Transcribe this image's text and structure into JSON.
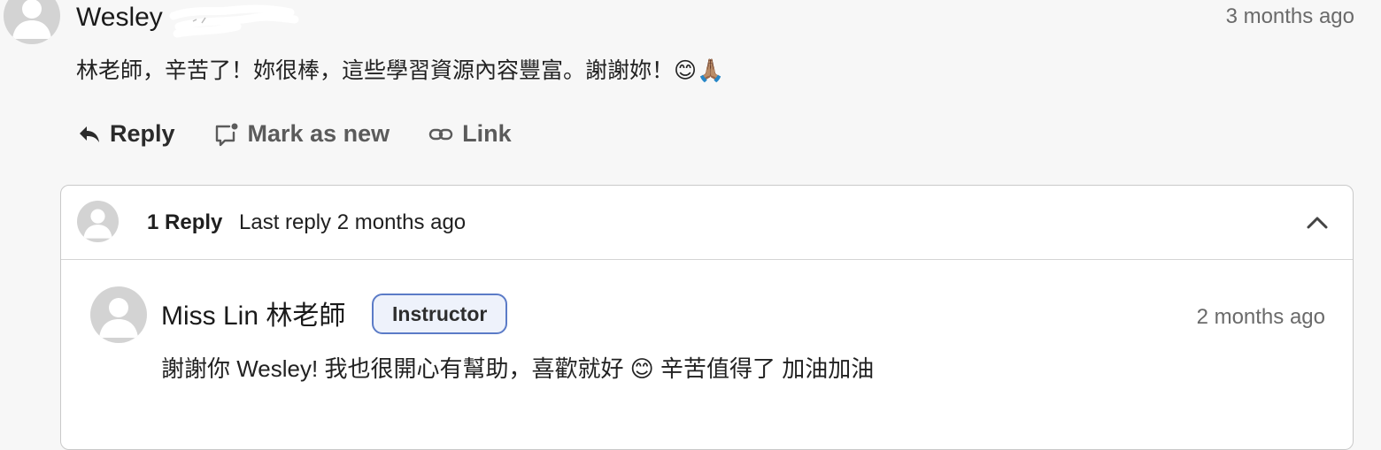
{
  "comment": {
    "author": "Wesley",
    "time": "3 months ago",
    "body": "林老師，辛苦了！妳很棒，這些學習資源內容豐富。謝謝妳！😊🙏🏽"
  },
  "actions": {
    "reply": "Reply",
    "mark_as_new": "Mark as new",
    "link": "Link"
  },
  "thread": {
    "reply_count": "1 Reply",
    "last_reply": "Last reply 2 months ago"
  },
  "reply": {
    "author": "Miss Lin 林老師",
    "badge": "Instructor",
    "time": "2 months ago",
    "body": "謝謝你 Wesley! 我也很開心有幫助，喜歡就好 😊 辛苦值得了 加油加油"
  },
  "icons": {
    "avatar": "default-avatar-icon",
    "reply": "reply-arrow-icon",
    "mark_as_new": "comment-dot-icon",
    "link": "link-icon",
    "collapse": "chevron-up-icon"
  },
  "colors": {
    "background": "#f7f7f7",
    "badge_border": "#5b7bc7",
    "badge_fill": "#eef2fb"
  }
}
